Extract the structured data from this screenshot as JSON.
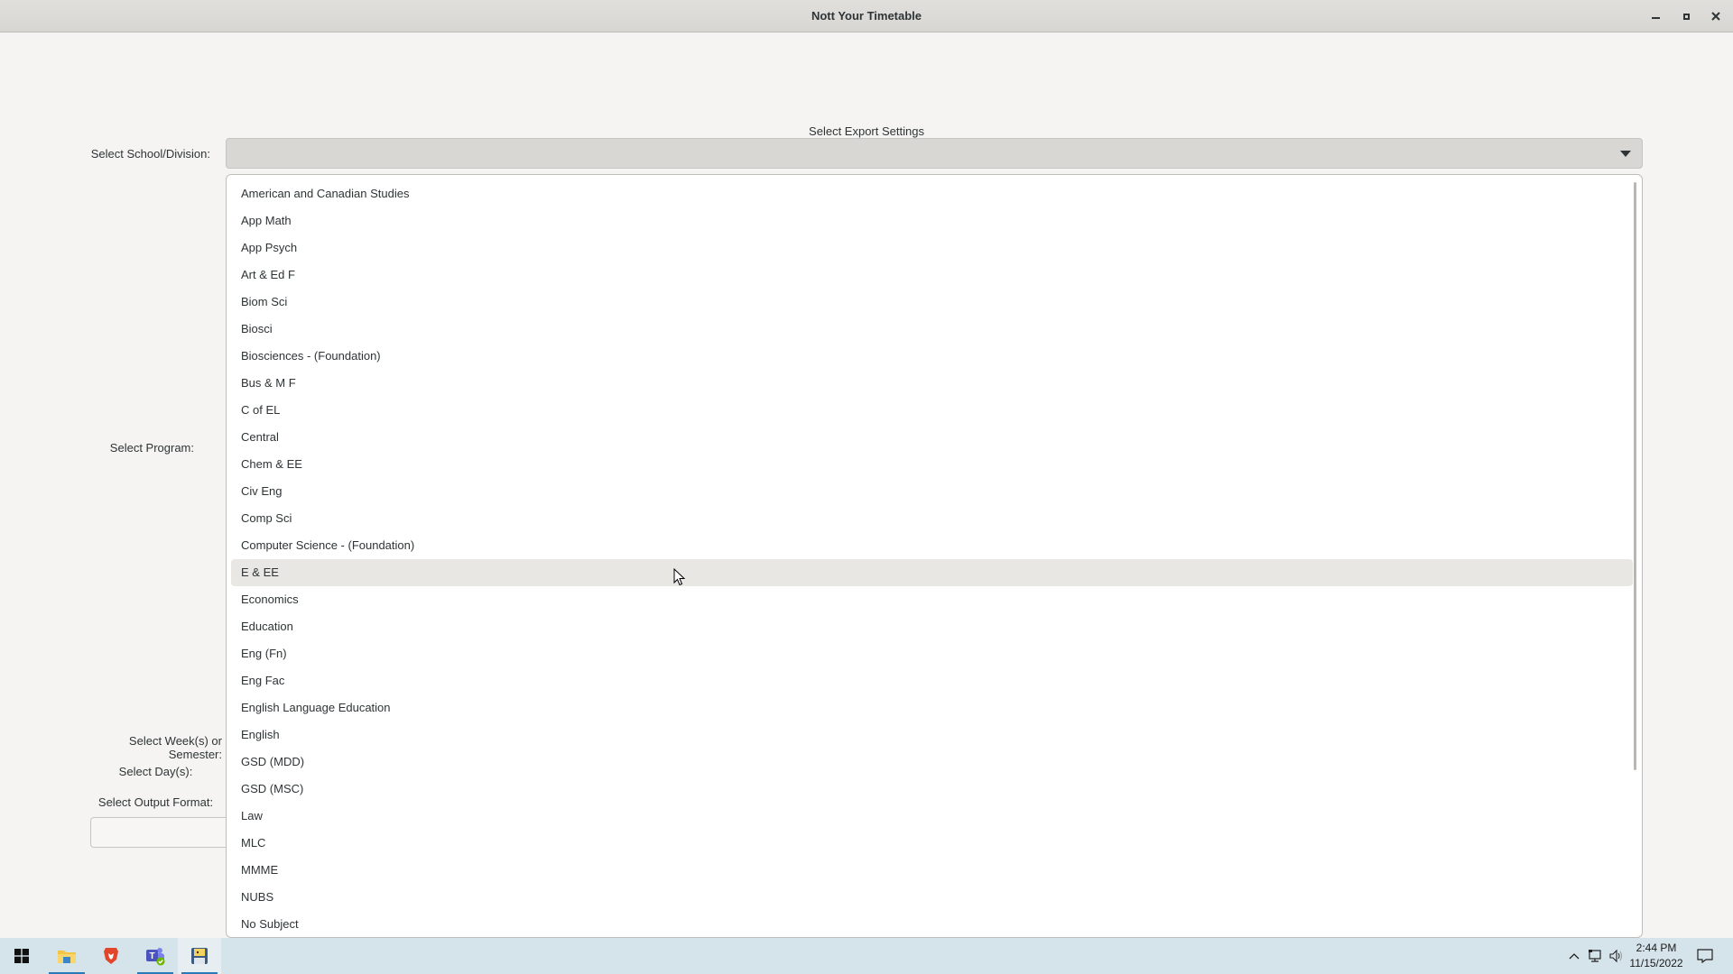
{
  "window": {
    "title": "Nott Your Timetable",
    "controls": {
      "minimize": "minimize",
      "maximize": "maximize",
      "close": "close"
    }
  },
  "form": {
    "section_title": "Select Export Settings",
    "labels": {
      "school": "Select School/Division:",
      "program": "Select Program:",
      "weeks": "Select Week(s) or Semester:",
      "days": "Select Day(s):",
      "format": "Select Output Format:"
    },
    "school_combo": {
      "value": "",
      "open": true,
      "hovered_index": 14,
      "options": [
        "American and Canadian Studies",
        "App Math",
        "App Psych",
        "Art & Ed F",
        "Biom Sci",
        "Biosci",
        "Biosciences - (Foundation)",
        "Bus & M F",
        "C of EL",
        "Central",
        "Chem & EE",
        "Civ Eng",
        "Comp Sci",
        "Computer Science - (Foundation)",
        "E & EE",
        "Economics",
        "Education",
        "Eng (Fn)",
        "Eng Fac",
        "English Language Education",
        "English",
        "GSD (MDD)",
        "GSD (MSC)",
        "Law",
        "MLC",
        "MMME",
        "NUBS",
        "No Subject"
      ]
    }
  },
  "taskbar": {
    "apps": [
      {
        "name": "start",
        "icon": "windows-logo-icon"
      },
      {
        "name": "file-explorer",
        "icon": "folder-icon",
        "running": true
      },
      {
        "name": "brave",
        "icon": "brave-lion-icon"
      },
      {
        "name": "teams",
        "icon": "teams-icon",
        "running": true
      },
      {
        "name": "nott-your-timetable",
        "icon": "app-icon",
        "running": true,
        "active": true
      }
    ],
    "clock": {
      "time": "2:44 PM",
      "date": "11/15/2022"
    },
    "colors": {
      "background": "#d5e3ea",
      "accent": "#2a7ab8"
    }
  }
}
